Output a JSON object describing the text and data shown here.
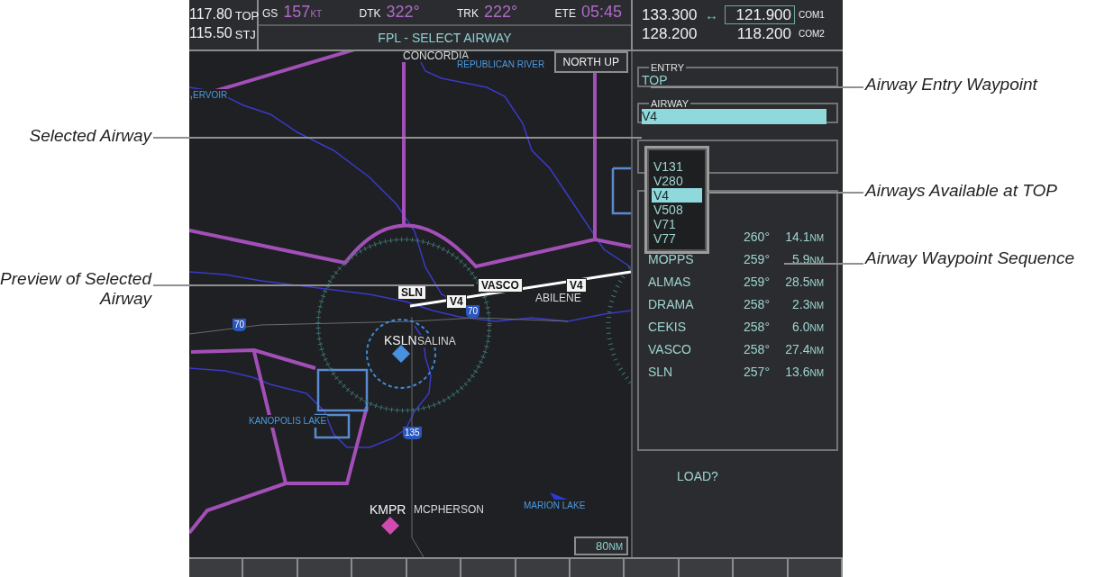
{
  "nav": [
    {
      "freq": "117.80",
      "id": "TOP"
    },
    {
      "freq": "115.50",
      "id": "STJ"
    }
  ],
  "data_bar": [
    {
      "label": "GS",
      "value": "157",
      "unit": "KT"
    },
    {
      "label": "DTK",
      "value": "322°"
    },
    {
      "label": "TRK",
      "value": "222°"
    },
    {
      "label": "ETE",
      "value": "05:45"
    }
  ],
  "page_title": "FPL - SELECT AIRWAY",
  "com": [
    {
      "standby": "133.300",
      "swap": "↔",
      "active": "121.900",
      "label": "COM1",
      "selected": true
    },
    {
      "standby": "128.200",
      "active": "118.200",
      "label": "COM2",
      "selected": false
    }
  ],
  "map": {
    "orientation": "NORTH UP",
    "range": "80",
    "range_unit": "NM",
    "labels": [
      {
        "text": "CONCORDIA",
        "kind": "place"
      },
      {
        "text": "REPUBLICAN RIVER",
        "kind": "water"
      },
      {
        "text": "ERVOIR",
        "kind": "water"
      },
      {
        "text": "VASCO",
        "kind": "tag"
      },
      {
        "text": "V4",
        "kind": "tag"
      },
      {
        "text": "SLN",
        "kind": "tag"
      },
      {
        "text": "V4",
        "kind": "tag"
      },
      {
        "text": "ABILENE",
        "kind": "place"
      },
      {
        "text": "70",
        "kind": "shield"
      },
      {
        "text": "70",
        "kind": "shield"
      },
      {
        "text": "KSLN",
        "kind": "airport"
      },
      {
        "text": "SALINA",
        "kind": "place"
      },
      {
        "text": "KANOPOLIS LAKE",
        "kind": "water"
      },
      {
        "text": "135",
        "kind": "shield"
      },
      {
        "text": "KMPR",
        "kind": "airport"
      },
      {
        "text": "MCPHERSON",
        "kind": "place"
      },
      {
        "text": "MARION LAKE",
        "kind": "water"
      }
    ]
  },
  "entry": {
    "label": "ENTRY",
    "value": "TOP"
  },
  "airway": {
    "label": "AIRWAY",
    "value": "V4"
  },
  "airway_options": [
    {
      "label": "V131",
      "selected": false
    },
    {
      "label": "V280",
      "selected": false
    },
    {
      "label": "V4",
      "selected": true
    },
    {
      "label": "V508",
      "selected": false
    },
    {
      "label": "V71",
      "selected": false
    },
    {
      "label": "V77",
      "selected": false
    }
  ],
  "waypoints": [
    {
      "dtk": "260°",
      "dist": "14.1",
      "unit": "NM"
    },
    {
      "name": "MOPPS",
      "dtk": "259°",
      "dist": "5.9",
      "unit": "NM"
    },
    {
      "name": "ALMAS",
      "dtk": "259°",
      "dist": "28.5",
      "unit": "NM"
    },
    {
      "name": "DRAMA",
      "dtk": "258°",
      "dist": "2.3",
      "unit": "NM"
    },
    {
      "name": "CEKIS",
      "dtk": "258°",
      "dist": "6.0",
      "unit": "NM"
    },
    {
      "name": "VASCO",
      "dtk": "258°",
      "dist": "27.4",
      "unit": "NM"
    },
    {
      "name": "SLN",
      "dtk": "257°",
      "dist": "13.6",
      "unit": "NM"
    }
  ],
  "load_prompt": "LOAD?",
  "callouts": [
    {
      "text": "Airway Entry Waypoint"
    },
    {
      "text": "Selected Airway"
    },
    {
      "text": "Airways Available at TOP"
    },
    {
      "text": "Airway Waypoint Sequence"
    },
    {
      "text": "Preview of Selected Airway"
    }
  ]
}
